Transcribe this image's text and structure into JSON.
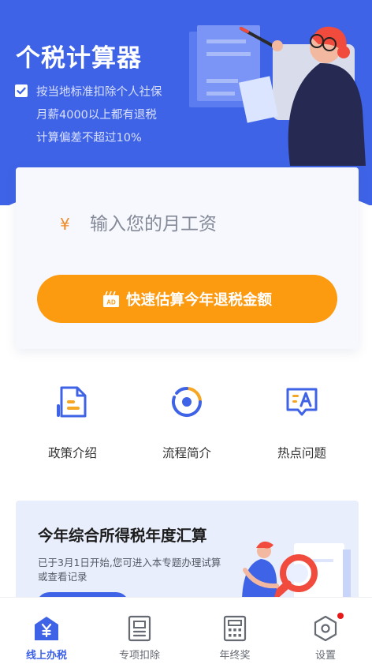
{
  "hero": {
    "title": "个税计算器",
    "bullets": [
      "按当地标准扣除个人社保",
      "月薪4000以上都有退税",
      "计算偏差不超过10%"
    ]
  },
  "calculator": {
    "currency_symbol": "¥",
    "salary_placeholder": "输入您的月工资",
    "cta_label": "快速估算今年退税金额",
    "ad_badge": "AD"
  },
  "shortcuts": [
    {
      "label": "政策介绍",
      "icon": "document-icon"
    },
    {
      "label": "流程简介",
      "icon": "process-cycle-icon"
    },
    {
      "label": "热点问题",
      "icon": "qa-chat-icon"
    }
  ],
  "banner": {
    "title": "今年综合所得税年度汇算",
    "description": "已于3月1日开始,您可进入本专题办理试算或查看记录"
  },
  "tabbar": {
    "tabs": [
      {
        "label": "线上办税",
        "icon": "home-yen-icon",
        "active": true
      },
      {
        "label": "专项扣除",
        "icon": "list-document-icon",
        "active": false
      },
      {
        "label": "年终奖",
        "icon": "calculator-icon",
        "active": false
      },
      {
        "label": "设置",
        "icon": "settings-hexagon-icon",
        "active": false,
        "badge_dot": true
      }
    ]
  },
  "colors": {
    "primary": "#3f63e6",
    "accent_orange": "#fc9a10",
    "card_bg": "#f6f8fd",
    "notification_red": "#e81818"
  }
}
